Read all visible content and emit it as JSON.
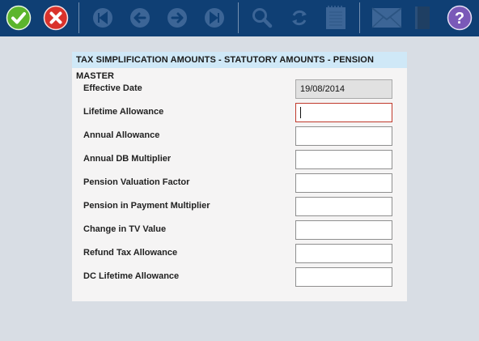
{
  "toolbar": {
    "buttons": [
      {
        "name": "save-button",
        "icon": "checkmark-icon"
      },
      {
        "name": "cancel-button",
        "icon": "close-icon"
      },
      {
        "name": "first-record-button",
        "icon": "skip-first-icon"
      },
      {
        "name": "previous-record-button",
        "icon": "arrow-left-icon"
      },
      {
        "name": "next-record-button",
        "icon": "arrow-right-icon"
      },
      {
        "name": "last-record-button",
        "icon": "skip-last-icon"
      },
      {
        "name": "search-button",
        "icon": "magnifier-icon"
      },
      {
        "name": "refresh-button",
        "icon": "refresh-icon"
      },
      {
        "name": "notes-button",
        "icon": "notepad-icon"
      },
      {
        "name": "email-button",
        "icon": "envelope-icon"
      },
      {
        "name": "book-button",
        "icon": "book-icon"
      },
      {
        "name": "help-button",
        "icon": "help-icon"
      }
    ],
    "colors": {
      "background": "#0f3f74",
      "save": "#5cb52d",
      "cancel": "#d9322b",
      "help": "#7a59b8",
      "disabled_icon": "#3c6596"
    }
  },
  "panel": {
    "title": "TAX SIMPLIFICATION AMOUNTS - STATUTORY AMOUNTS - PENSION MASTER",
    "fields": [
      {
        "label": "Effective Date",
        "value": "19/08/2014",
        "disabled": true
      },
      {
        "label": "Lifetime Allowance",
        "value": "",
        "focused": true
      },
      {
        "label": "Annual Allowance",
        "value": ""
      },
      {
        "label": "Annual DB Multiplier",
        "value": ""
      },
      {
        "label": "Pension Valuation Factor",
        "value": ""
      },
      {
        "label": "Pension in Payment Multiplier",
        "value": ""
      },
      {
        "label": "Change in TV Value",
        "value": ""
      },
      {
        "label": "Refund Tax Allowance",
        "value": ""
      },
      {
        "label": "DC Lifetime Allowance",
        "value": ""
      }
    ]
  }
}
